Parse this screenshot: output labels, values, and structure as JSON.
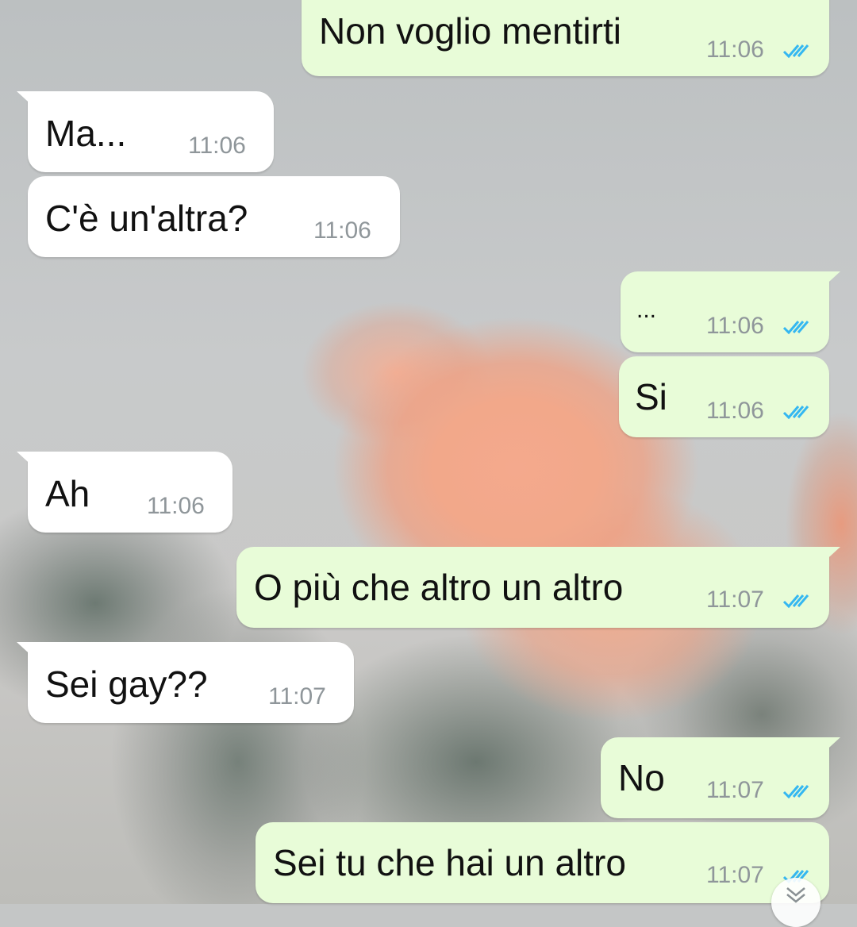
{
  "colors": {
    "incoming_bubble": "#ffffff",
    "outgoing_bubble": "#e8fcd8",
    "read_ticks": "#34b7f1",
    "timestamp": "#8f969a"
  },
  "messages": [
    {
      "direction": "outgoing",
      "text": "Non voglio mentirti",
      "time": "11:06",
      "status": "read"
    },
    {
      "direction": "incoming",
      "text": "Ma...",
      "time": "11:06"
    },
    {
      "direction": "incoming",
      "text": "C'è un'altra?",
      "time": "11:06"
    },
    {
      "direction": "outgoing",
      "text": "...",
      "time": "11:06",
      "status": "read"
    },
    {
      "direction": "outgoing",
      "text": "Si",
      "time": "11:06",
      "status": "read"
    },
    {
      "direction": "incoming",
      "text": "Ah",
      "time": "11:06"
    },
    {
      "direction": "outgoing",
      "text": "O più che altro un altro",
      "time": "11:07",
      "status": "read"
    },
    {
      "direction": "incoming",
      "text": "Sei gay??",
      "time": "11:07"
    },
    {
      "direction": "outgoing",
      "text": "No",
      "time": "11:07",
      "status": "read"
    },
    {
      "direction": "outgoing",
      "text": "Sei tu che hai un altro",
      "time": "11:07",
      "status": "read"
    }
  ],
  "scroll_button_icon": "double-chevron-down-icon",
  "tick_icon": "double-check-icon"
}
